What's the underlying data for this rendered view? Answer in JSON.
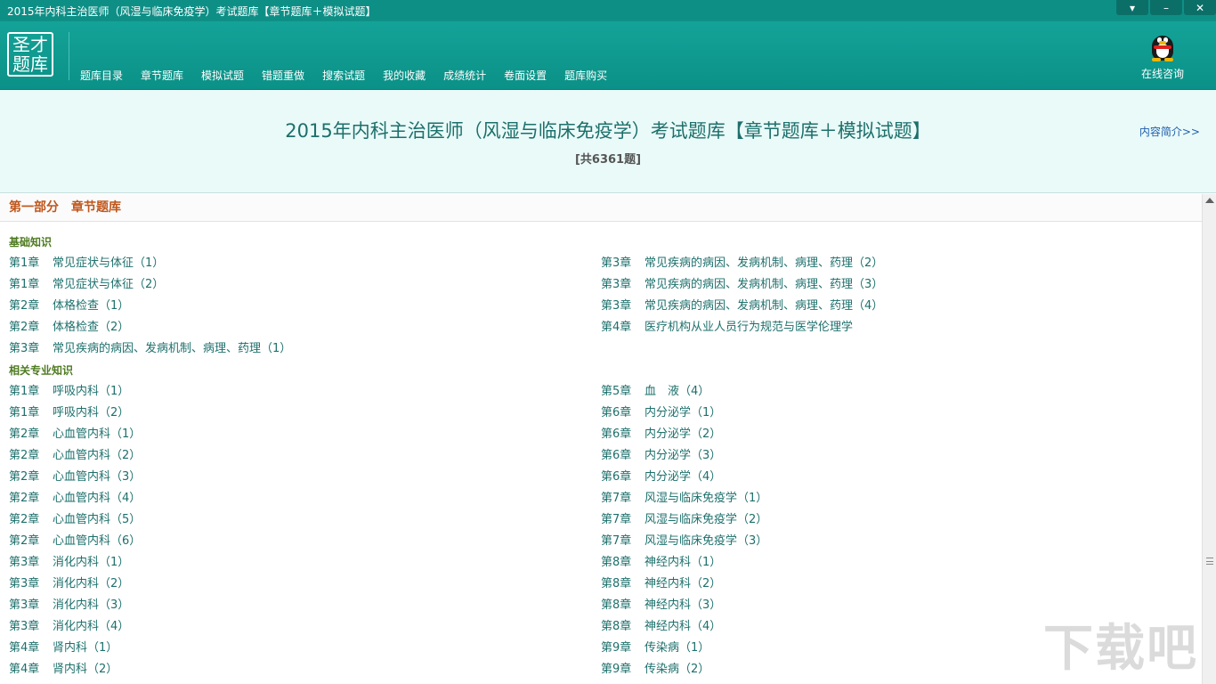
{
  "window": {
    "title": "2015年内科主治医师（风湿与临床免疫学）考试题库【章节题库＋模拟试题】",
    "buttons": {
      "menu": "▾",
      "minimize": "–",
      "close": "✕"
    }
  },
  "logo": {
    "line1": "圣才",
    "line2": "题库"
  },
  "nav": [
    "题库目录",
    "章节题库",
    "模拟试题",
    "错题重做",
    "搜索试题",
    "我的收藏",
    "成绩统计",
    "卷面设置",
    "题库购买"
  ],
  "consult": {
    "label": "在线咨询"
  },
  "header": {
    "title": "2015年内科主治医师（风湿与临床免疫学）考试题库【章节题库＋模拟试题】",
    "count": "[共6361题]",
    "intro_link": "内容简介>>"
  },
  "part": {
    "label": "第一部分",
    "name": "章节题库"
  },
  "sections": [
    {
      "title": "基础知识",
      "left": [
        {
          "ch": "第1章",
          "name": "常见症状与体征（1）"
        },
        {
          "ch": "第1章",
          "name": "常见症状与体征（2）"
        },
        {
          "ch": "第2章",
          "name": "体格检查（1）"
        },
        {
          "ch": "第2章",
          "name": "体格检查（2）"
        },
        {
          "ch": "第3章",
          "name": "常见疾病的病因、发病机制、病理、药理（1）"
        }
      ],
      "right": [
        {
          "ch": "第3章",
          "name": "常见疾病的病因、发病机制、病理、药理（2）"
        },
        {
          "ch": "第3章",
          "name": "常见疾病的病因、发病机制、病理、药理（3）"
        },
        {
          "ch": "第3章",
          "name": "常见疾病的病因、发病机制、病理、药理（4）"
        },
        {
          "ch": "第4章",
          "name": "医疗机构从业人员行为规范与医学伦理学"
        }
      ]
    },
    {
      "title": "相关专业知识",
      "left": [
        {
          "ch": "第1章",
          "name": "呼吸内科（1）"
        },
        {
          "ch": "第1章",
          "name": "呼吸内科（2）"
        },
        {
          "ch": "第2章",
          "name": "心血管内科（1）"
        },
        {
          "ch": "第2章",
          "name": "心血管内科（2）"
        },
        {
          "ch": "第2章",
          "name": "心血管内科（3）"
        },
        {
          "ch": "第2章",
          "name": "心血管内科（4）"
        },
        {
          "ch": "第2章",
          "name": "心血管内科（5）"
        },
        {
          "ch": "第2章",
          "name": "心血管内科（6）"
        },
        {
          "ch": "第3章",
          "name": "消化内科（1）"
        },
        {
          "ch": "第3章",
          "name": "消化内科（2）"
        },
        {
          "ch": "第3章",
          "name": "消化内科（3）"
        },
        {
          "ch": "第3章",
          "name": "消化内科（4）"
        },
        {
          "ch": "第4章",
          "name": "肾内科（1）"
        },
        {
          "ch": "第4章",
          "name": "肾内科（2）"
        }
      ],
      "right": [
        {
          "ch": "第5章",
          "name": "血　液（4）"
        },
        {
          "ch": "第6章",
          "name": "内分泌学（1）"
        },
        {
          "ch": "第6章",
          "name": "内分泌学（2）"
        },
        {
          "ch": "第6章",
          "name": "内分泌学（3）"
        },
        {
          "ch": "第6章",
          "name": "内分泌学（4）"
        },
        {
          "ch": "第7章",
          "name": "风湿与临床免疫学（1）"
        },
        {
          "ch": "第7章",
          "name": "风湿与临床免疫学（2）"
        },
        {
          "ch": "第7章",
          "name": "风湿与临床免疫学（3）"
        },
        {
          "ch": "第8章",
          "name": "神经内科（1）"
        },
        {
          "ch": "第8章",
          "name": "神经内科（2）"
        },
        {
          "ch": "第8章",
          "name": "神经内科（3）"
        },
        {
          "ch": "第8章",
          "name": "神经内科（4）"
        },
        {
          "ch": "第9章",
          "name": "传染病（1）"
        },
        {
          "ch": "第9章",
          "name": "传染病（2）"
        }
      ]
    }
  ],
  "watermark": "下载吧"
}
